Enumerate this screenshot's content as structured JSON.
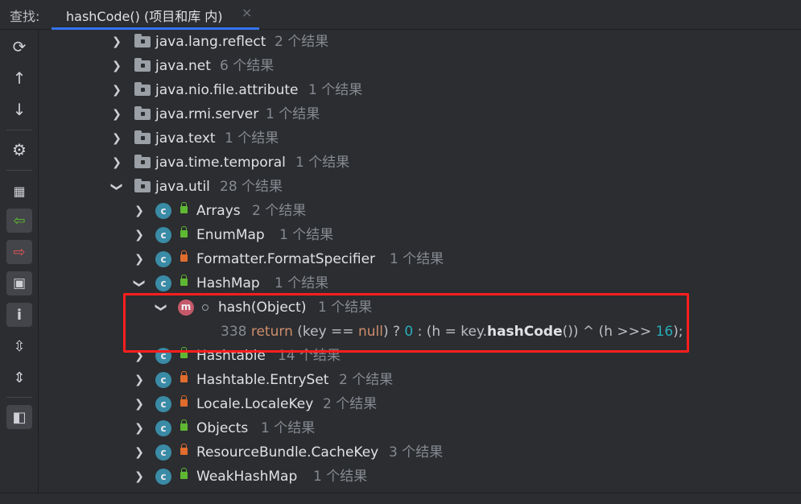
{
  "find_label": "查找:",
  "tab": {
    "title": "hashCode() (项目和库 内)",
    "close": "×"
  },
  "toolbar": [
    "refresh-icon",
    "arrow-up-icon",
    "arrow-down-icon",
    "gear-icon",
    "group-icon",
    "previous-occurrence-icon",
    "next-occurrence-icon",
    "module-icon",
    "info-icon",
    "expand-all-icon",
    "collapse-all-icon",
    "preview-icon"
  ],
  "packages": [
    {
      "name": "java.lang.reflect",
      "count": "2 个结果"
    },
    {
      "name": "java.net",
      "count": "6 个结果"
    },
    {
      "name": "java.nio.file.attribute",
      "count": "1 个结果"
    },
    {
      "name": "java.rmi.server",
      "count": "1 个结果"
    },
    {
      "name": "java.text",
      "count": "1 个结果"
    },
    {
      "name": "java.time.temporal",
      "count": "1 个结果"
    },
    {
      "name": "java.util",
      "count": "28 个结果"
    }
  ],
  "classes_top": [
    {
      "name": "Arrays",
      "count": "2 个结果",
      "access": "public"
    },
    {
      "name": "EnumMap",
      "count": "1 个结果",
      "access": "public"
    },
    {
      "name": "Formatter.FormatSpecifier",
      "count": "1 个结果",
      "access": "private"
    },
    {
      "name": "HashMap",
      "count": "1 个结果",
      "access": "public"
    }
  ],
  "method": {
    "name": "hash(Object)",
    "count": "1 个结果",
    "line": "338",
    "code": {
      "kw_return": "return",
      "p1": " (key == ",
      "kw_null": "null",
      "p2": ") ? ",
      "n0": "0",
      "p3": " : (h = key.",
      "bold": "hashCode",
      "p4": "()) ^ (h >>> ",
      "n16": "16",
      "p5": ");"
    }
  },
  "classes_bottom": [
    {
      "name": "Hashtable",
      "count": "14 个结果",
      "access": "public"
    },
    {
      "name": "Hashtable.EntrySet",
      "count": "2 个结果",
      "access": "private"
    },
    {
      "name": "Locale.LocaleKey",
      "count": "2 个结果",
      "access": "private"
    },
    {
      "name": "Objects",
      "count": "1 个结果",
      "access": "public"
    },
    {
      "name": "ResourceBundle.CacheKey",
      "count": "3 个结果",
      "access": "private"
    },
    {
      "name": "WeakHashMap",
      "count": "1 个结果",
      "access": "public"
    }
  ],
  "colors": {
    "highlight": "#ff1e1e",
    "accent": "#3574f0"
  }
}
